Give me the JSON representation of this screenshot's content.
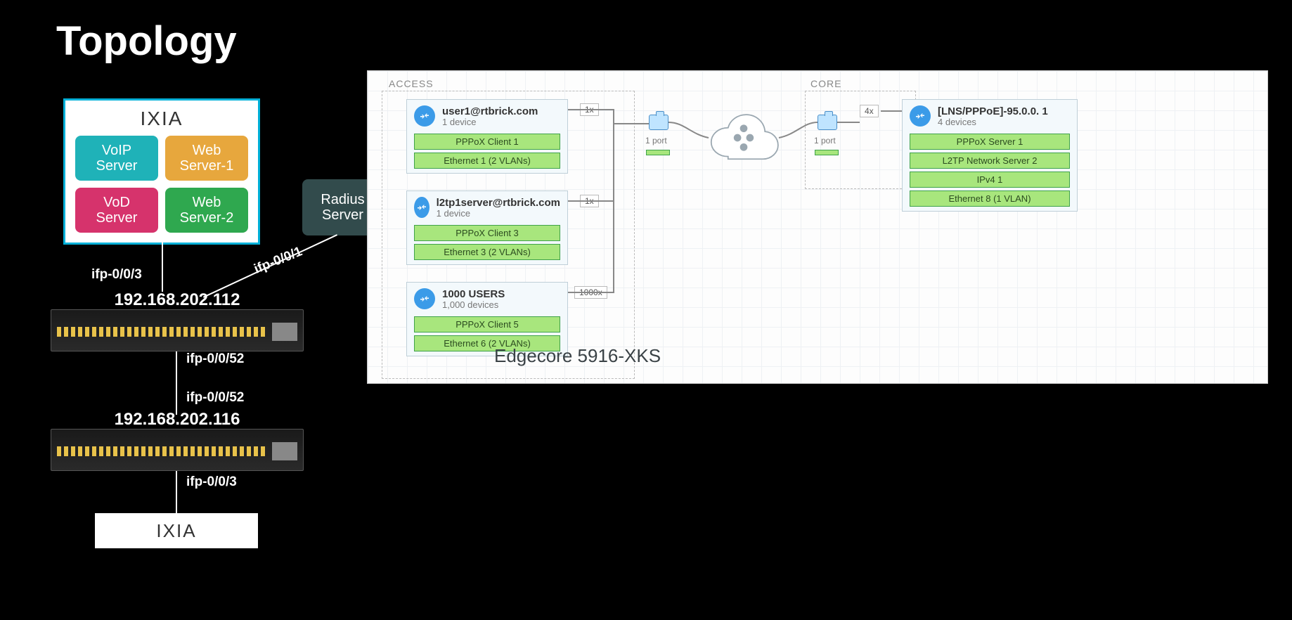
{
  "title": "Topology",
  "left": {
    "ixia_title_top": "IXIA",
    "tiles": {
      "voip": "VoIP\nServer",
      "web1": "Web\nServer-1",
      "vod": "VoD\nServer",
      "web2": "Web\nServer-2"
    },
    "radius": "Radius\nServer",
    "labels": {
      "ifp003": "ifp-0/0/3",
      "ifp001": "ifp-0/0/1",
      "ifp0052a": "ifp-0/0/52",
      "ifp0052b": "ifp-0/0/52",
      "ifp003b": "ifp-0/0/3"
    },
    "switch1_ip": "192.168.202.112",
    "switch2_ip": "192.168.202.116",
    "ixia_title_bottom": "IXIA"
  },
  "panel": {
    "zone_access": "ACCESS",
    "zone_core": "CORE",
    "overlay": "Edgecore 5916-XKS",
    "access": {
      "user1": {
        "title": "user1@rtbrick.com",
        "sub": "1 device",
        "stacks": [
          "PPPoX Client 1",
          "Ethernet 1 (2 VLANs)"
        ],
        "mult": "1x"
      },
      "l2tp": {
        "title": "l2tp1server@rtbrick.com",
        "sub": "1 device",
        "stacks": [
          "PPPoX Client 3",
          "Ethernet 3 (2 VLANs)"
        ],
        "mult": "1x"
      },
      "users": {
        "title": "1000 USERS",
        "sub": "1,000 devices",
        "stacks": [
          "PPPoX Client 5",
          "Ethernet 6 (2 VLANs)"
        ],
        "mult": "1000x"
      }
    },
    "port_left": {
      "label": "1 port"
    },
    "port_right": {
      "label": "1 port"
    },
    "core": {
      "title": "[LNS/PPPoE]-95.0.0. 1",
      "sub": "4 devices",
      "stacks": [
        "PPPoX Server 1",
        "L2TP Network Server 2",
        "IPv4 1",
        "Ethernet 8 (1 VLAN)"
      ],
      "mult": "4x"
    }
  }
}
